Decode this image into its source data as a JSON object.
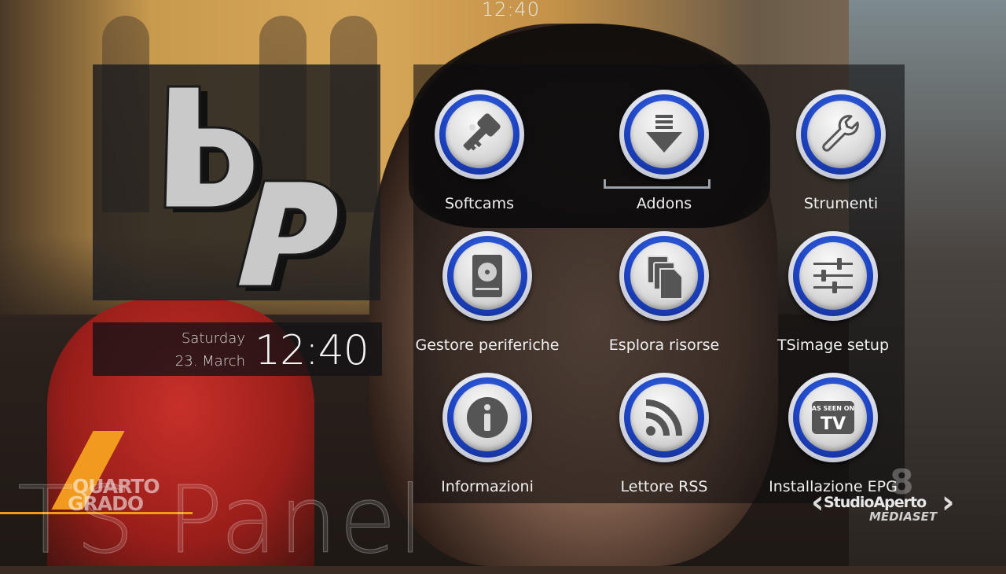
{
  "top_bar": {
    "clock": "12:40"
  },
  "logo": {
    "name": "bp-logo"
  },
  "datetime": {
    "day": "Saturday",
    "date": "23. March",
    "time": "12:40"
  },
  "menu": {
    "items": [
      {
        "label": "Softcams",
        "icon": "softcam-key-icon"
      },
      {
        "label": "Addons",
        "icon": "download-arrow-icon",
        "selected": true
      },
      {
        "label": "Strumenti",
        "icon": "wrench-icon"
      },
      {
        "label": "Gestore periferiche",
        "icon": "hard-drive-icon"
      },
      {
        "label": "Esplora risorse",
        "icon": "files-icon"
      },
      {
        "label": "TSimage setup",
        "icon": "sliders-icon"
      },
      {
        "label": "Informazioni",
        "icon": "info-icon"
      },
      {
        "label": "Lettore RSS",
        "icon": "rss-icon"
      },
      {
        "label": "Installazione EPG",
        "icon": "as-seen-on-tv-icon",
        "badge_top": "AS SEEN ON",
        "badge_main": "TV"
      }
    ]
  },
  "panel_title": "TS Panel",
  "overlays": {
    "channel_logo_line1": "QUARTO",
    "channel_logo_line2": "GRADO",
    "broadcaster_line1": "StudioAperto",
    "broadcaster_line2": "MEDIASET",
    "broadcaster_number": "8"
  },
  "colors": {
    "ring_blue": "#1d44c4",
    "accent_orange": "#f29a1e",
    "panel_bg": "#1c1c1e"
  }
}
